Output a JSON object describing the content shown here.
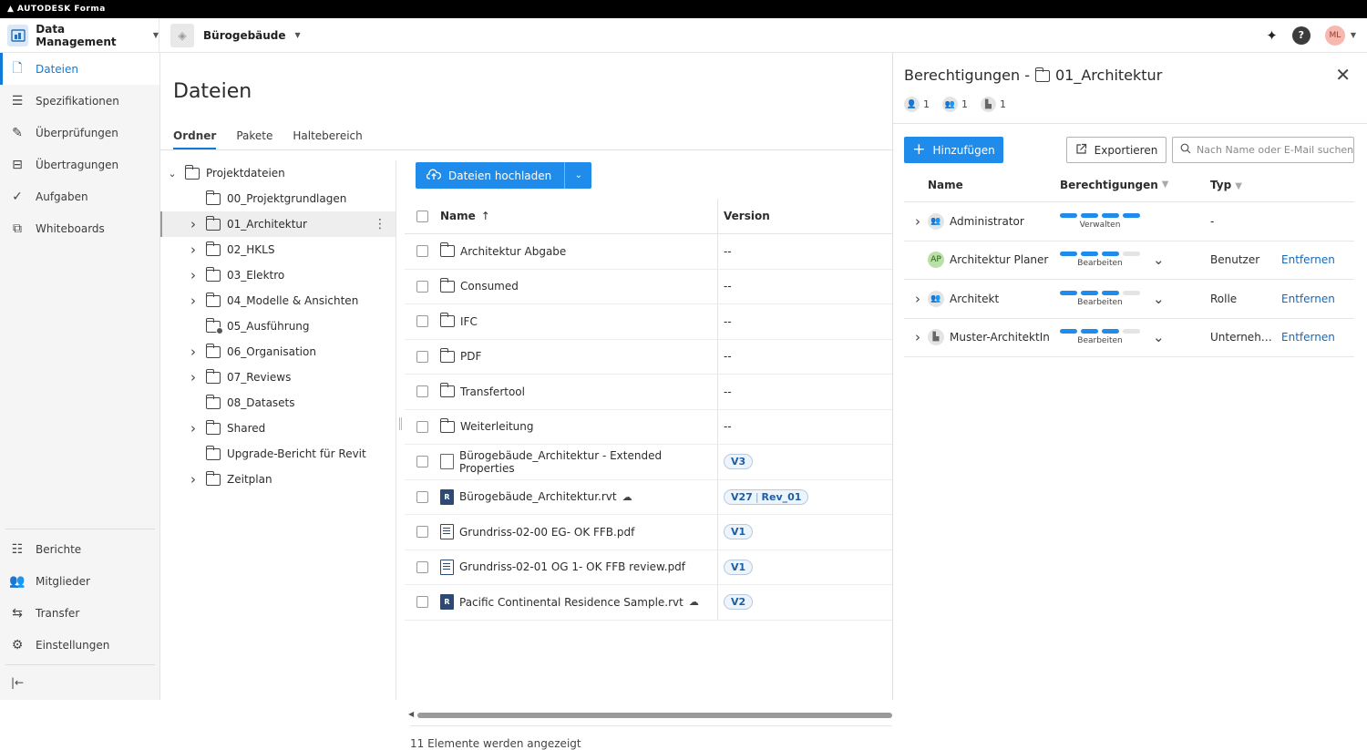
{
  "topbar": {
    "brand": "AUTODESK Forma"
  },
  "header": {
    "module": "Data Management",
    "project": "Bürogebäude",
    "user_initials": "ML",
    "help_label": "?"
  },
  "sidebar": {
    "items": [
      {
        "label": "Dateien",
        "icon": "file-icon",
        "glyph": "🗋"
      },
      {
        "label": "Spezifikationen",
        "icon": "specifications-icon",
        "glyph": "☰"
      },
      {
        "label": "Überprüfungen",
        "icon": "reviews-icon",
        "glyph": "✎"
      },
      {
        "label": "Übertragungen",
        "icon": "transmittals-icon",
        "glyph": "⊟"
      },
      {
        "label": "Aufgaben",
        "icon": "tasks-icon",
        "glyph": "✓"
      },
      {
        "label": "Whiteboards",
        "icon": "whiteboards-icon",
        "glyph": "⧉"
      }
    ],
    "bottom_items": [
      {
        "label": "Berichte",
        "icon": "reports-icon",
        "glyph": "☷"
      },
      {
        "label": "Mitglieder",
        "icon": "members-icon",
        "glyph": "👥"
      },
      {
        "label": "Transfer",
        "icon": "transfer-icon",
        "glyph": "⇆"
      },
      {
        "label": "Einstellungen",
        "icon": "settings-icon",
        "glyph": "⚙"
      }
    ],
    "collapse_glyph": "|←"
  },
  "main": {
    "title": "Dateien",
    "tabs": [
      "Ordner",
      "Pakete",
      "Haltebereich"
    ],
    "tree": {
      "root": "Projektdateien",
      "folders": [
        {
          "label": "00_Projektgrundlagen",
          "expandable": false
        },
        {
          "label": "01_Architektur",
          "expandable": true,
          "selected": true
        },
        {
          "label": "02_HKLS",
          "expandable": true
        },
        {
          "label": "03_Elektro",
          "expandable": true
        },
        {
          "label": "04_Modelle & Ansichten",
          "expandable": true
        },
        {
          "label": "05_Ausführung",
          "expandable": false,
          "special": true
        },
        {
          "label": "06_Organisation",
          "expandable": true
        },
        {
          "label": "07_Reviews",
          "expandable": true
        },
        {
          "label": "08_Datasets",
          "expandable": false
        },
        {
          "label": "Shared",
          "expandable": true
        },
        {
          "label": "Upgrade-Bericht für Revit",
          "expandable": false
        },
        {
          "label": "Zeitplan",
          "expandable": true
        }
      ]
    },
    "upload_label": "Dateien hochladen",
    "columns": {
      "name": "Name",
      "version": "Version"
    },
    "rows": [
      {
        "name": "Architektur Abgabe",
        "kind": "folder",
        "version": "--"
      },
      {
        "name": "Consumed",
        "kind": "folder",
        "version": "--"
      },
      {
        "name": "IFC",
        "kind": "folder",
        "version": "--"
      },
      {
        "name": "PDF",
        "kind": "folder",
        "version": "--"
      },
      {
        "name": "Transfertool",
        "kind": "folder",
        "version": "--"
      },
      {
        "name": "Weiterleitung",
        "kind": "folder",
        "version": "--"
      },
      {
        "name": "Bürogebäude_Architektur - Extended Properties",
        "kind": "ext",
        "version": "V3"
      },
      {
        "name": "Bürogebäude_Architektur.rvt",
        "kind": "rvt",
        "version": "V27",
        "revision": "Rev_01",
        "cloud": true
      },
      {
        "name": "Grundriss-02-00 EG- OK FFB.pdf",
        "kind": "pdf",
        "version": "V1"
      },
      {
        "name": "Grundriss-02-01 OG 1- OK FFB review.pdf",
        "kind": "pdf",
        "version": "V1"
      },
      {
        "name": "Pacific Continental Residence Sample.rvt",
        "kind": "rvt",
        "version": "V2",
        "cloud": true
      }
    ],
    "status": "11 Elemente werden angezeigt"
  },
  "panel": {
    "title_prefix": "Berechtigungen -",
    "title_folder": "01_Architektur",
    "counts": {
      "users": "1",
      "roles": "1",
      "companies": "1"
    },
    "add_label": "Hinzufügen",
    "export_label": "Exportieren",
    "search_placeholder": "Nach Name oder E-Mail suchen",
    "columns": {
      "name": "Name",
      "permissions": "Berechtigungen",
      "type": "Typ"
    },
    "rows": [
      {
        "name": "Administrator",
        "icon": "role",
        "level": 4,
        "level_label": "Verwalten",
        "type": "-",
        "action": "",
        "expandable": true,
        "dropdown": false
      },
      {
        "name": "Architektur Planer",
        "icon": "user",
        "initials": "AP",
        "level": 3,
        "level_label": "Bearbeiten",
        "type": "Benutzer",
        "action": "Entfernen",
        "expandable": false,
        "dropdown": true
      },
      {
        "name": "Architekt",
        "icon": "role",
        "level": 3,
        "level_label": "Bearbeiten",
        "type": "Rolle",
        "action": "Entfernen",
        "expandable": true,
        "dropdown": true
      },
      {
        "name": "Muster-ArchitektIn",
        "icon": "company",
        "level": 3,
        "level_label": "Bearbeiten",
        "type": "Unterneh…",
        "action": "Entfernen",
        "expandable": true,
        "dropdown": true
      }
    ]
  },
  "colors": {
    "accent": "#1f8ceb",
    "link": "#0f6bc2",
    "avatar": "#f7b8b0"
  }
}
